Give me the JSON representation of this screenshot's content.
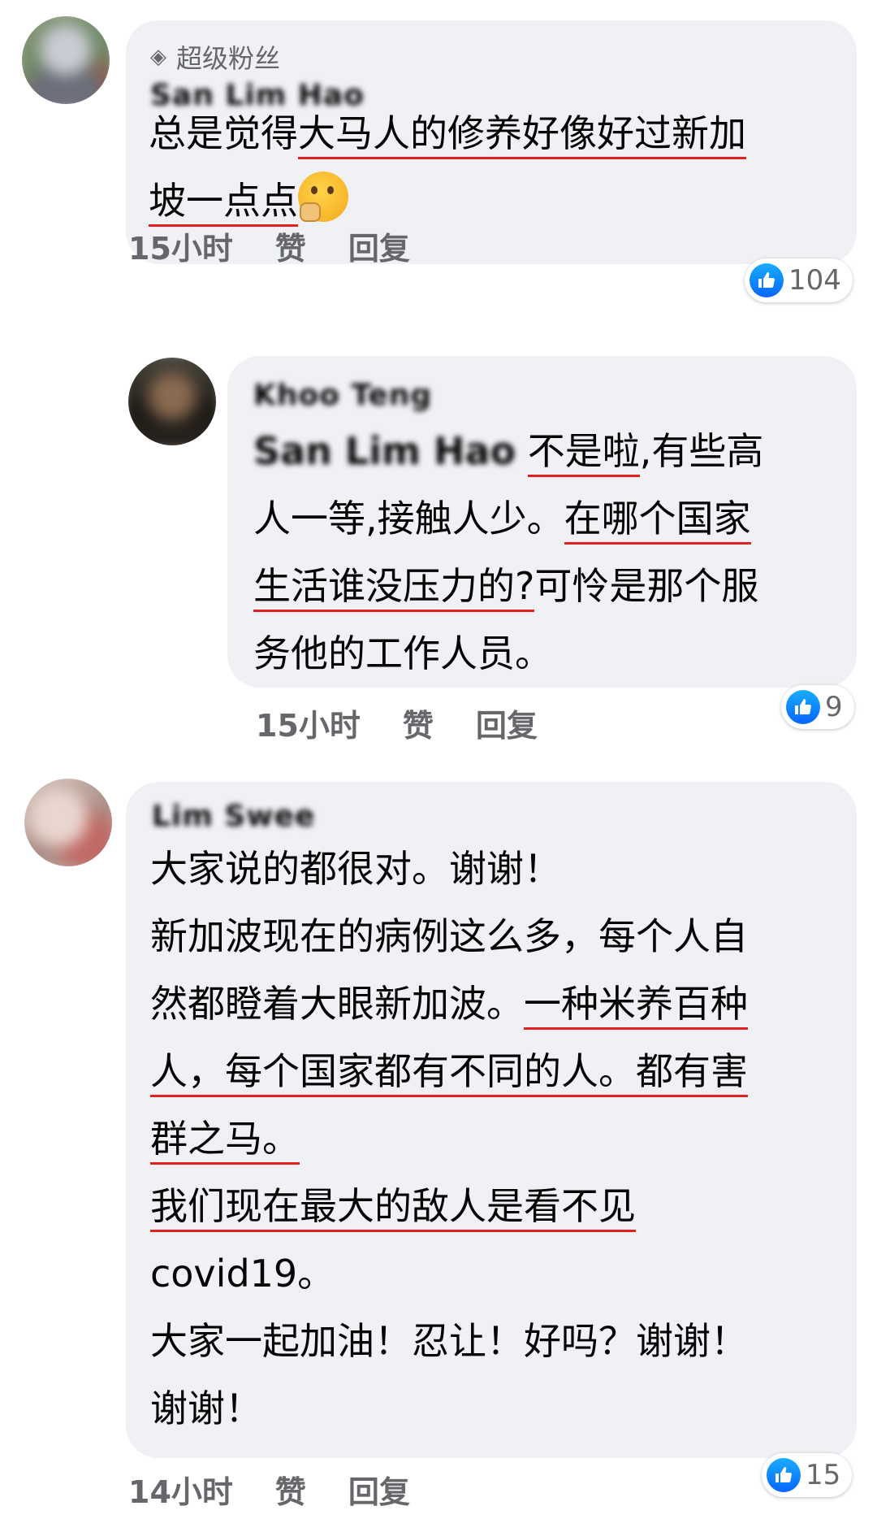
{
  "colors": {
    "bubble_bg": "#eff1f5",
    "underline": "#e02020",
    "meta_text": "#65676b",
    "like_blue": "#0866ff"
  },
  "comments": [
    {
      "badge_icon": "diamond-icon",
      "badge": "超级粉丝",
      "author": "San Lim Hao",
      "lines": [
        [
          "总是觉得",
          "大马人的修养好像好过新加"
        ],
        [
          "坡一点点"
        ]
      ],
      "time": "15小时",
      "like_label": "赞",
      "reply_label": "回复",
      "reaction_count": "104"
    },
    {
      "author": "Khoo Teng",
      "mention": "San Lim Hao",
      "lines": [
        [
          "不是啦",
          ",有些高"
        ],
        [
          "人一等,接触人少。",
          "在哪个国家"
        ],
        [
          "生活谁没压力的?",
          "可怜是那个服"
        ],
        [
          "务他的工作人员。"
        ]
      ],
      "time": "15小时",
      "like_label": "赞",
      "reply_label": "回复",
      "reaction_count": "9"
    },
    {
      "author": "Lim Swee",
      "lines": [
        "大家说的都很对。谢谢！",
        "新加波现在的病例这么多，每个人自",
        [
          "然都瞪着大眼新加波。",
          "一种米养百种"
        ],
        "人，每个国家都有不同的人。都有害",
        "群之马。",
        "我们现在最大的敌人是看不见",
        "covid19。",
        "大家一起加油！忍让！好吗？谢谢！",
        "谢谢！"
      ],
      "time": "14小时",
      "like_label": "赞",
      "reply_label": "回复",
      "reaction_count": "15"
    }
  ]
}
